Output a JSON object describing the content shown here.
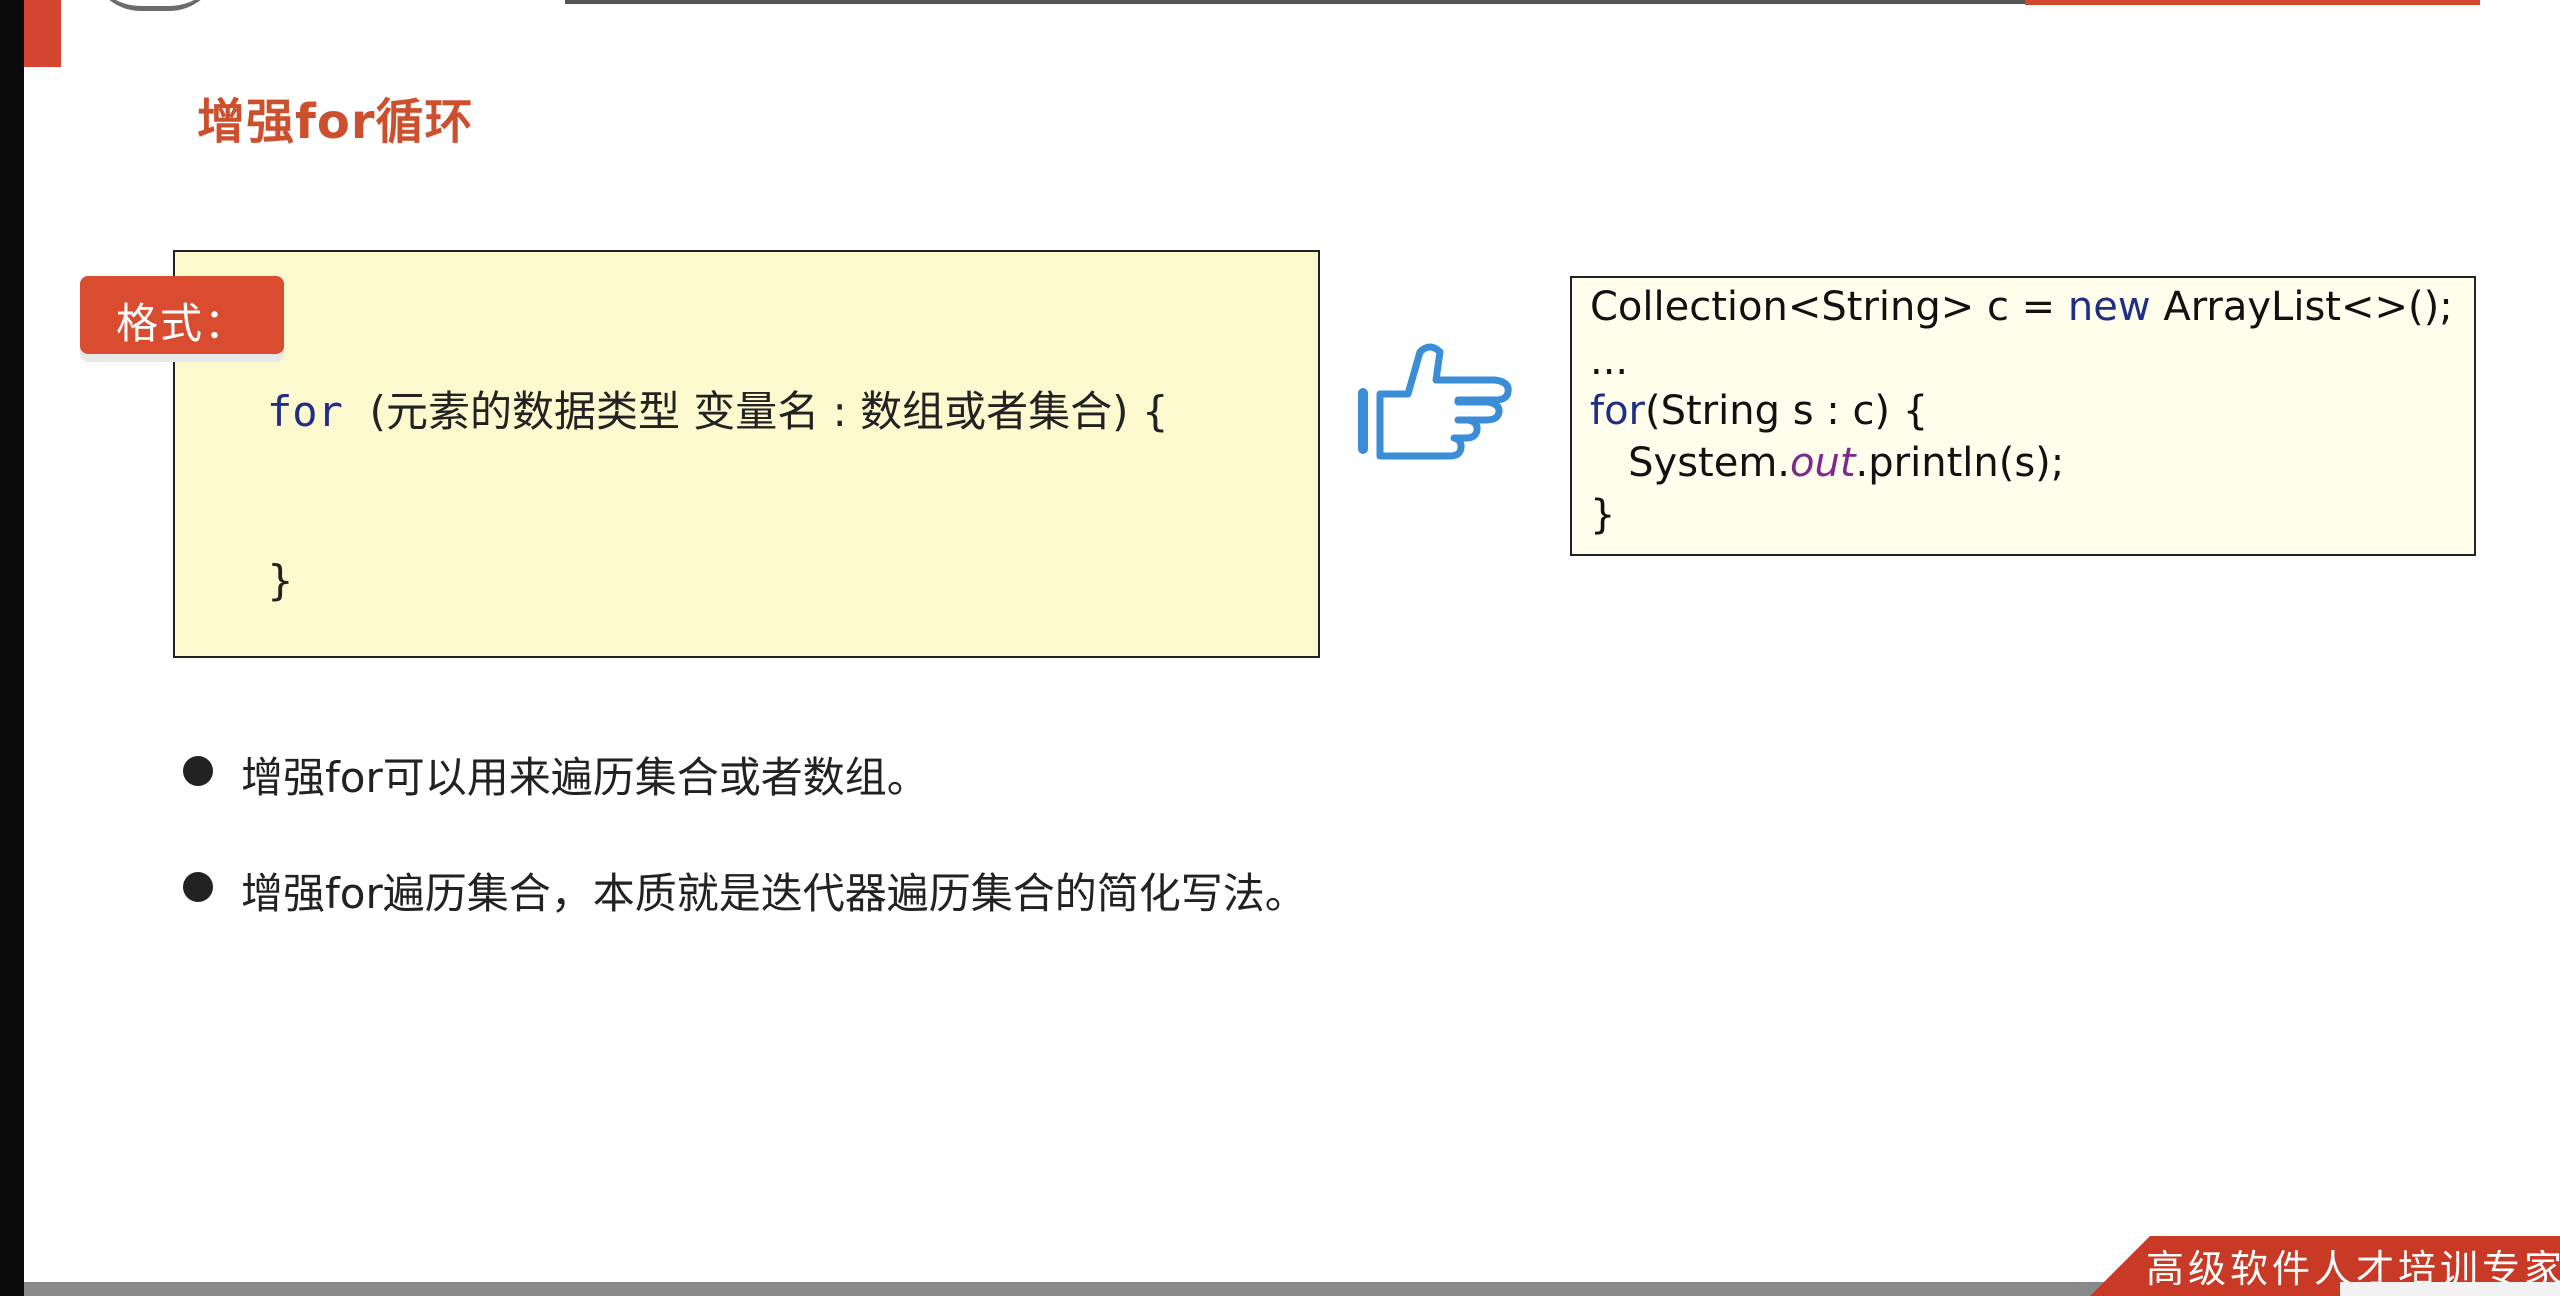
{
  "slide": {
    "title": "增强for循环",
    "format_label": "格式：",
    "format_code": {
      "keyword": "for",
      "rest": "  (元素的数据类型 变量名 : 数组或者集合) {",
      "closing": "}"
    },
    "hand_icon": "pointing-hand-icon",
    "example_code": {
      "line1_prefix": "Collection<String> c = ",
      "line1_kw": "new",
      "line1_suffix": " ArrayList<>();",
      "line2": "...",
      "line3_kw": "for",
      "line3_rest": "(String s : c) {",
      "line4_prefix": "   System.",
      "line4_italic": "out",
      "line4_suffix": ".println(s);",
      "line5": "}"
    },
    "bullets": [
      "增强for可以用来遍历集合或者数组。",
      "增强for遍历集合，本质就是迭代器遍历集合的简化写法。"
    ],
    "footer_text": "高级软件人才培训专家"
  },
  "colors": {
    "accent_red": "#d4452f",
    "title_color": "#cc4f2e",
    "code_keyword": "#1f2e86",
    "format_box_bg": "#fdf9cf",
    "example_box_bg": "#fffdec",
    "hand_blue": "#3a8ed8"
  }
}
